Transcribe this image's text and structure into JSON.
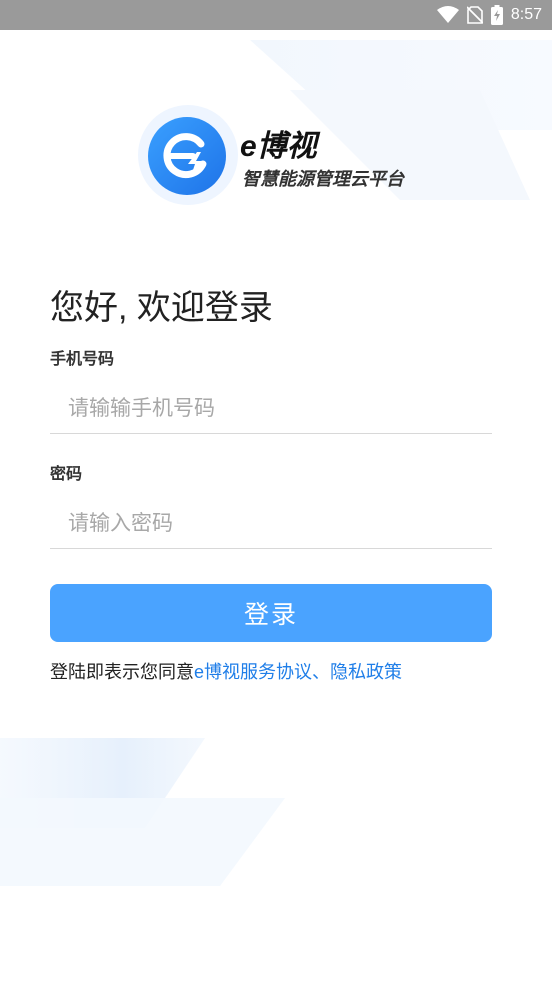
{
  "status_bar": {
    "time": "8:57",
    "icons": [
      "wifi-icon",
      "no-sim-icon",
      "battery-charging-icon"
    ]
  },
  "brand": {
    "title": "e博视",
    "subtitle": "智慧能源管理云平台",
    "logo_icon": "lightning-e-logo-icon",
    "accent_color": "#1e73e8"
  },
  "form": {
    "greeting": "您好, 欢迎登录",
    "phone": {
      "label": "手机号码",
      "placeholder": "请输输手机号码",
      "value": ""
    },
    "password": {
      "label": "密码",
      "placeholder": "请输入密码",
      "value": ""
    },
    "submit_label": "登录",
    "submit_color": "#4aa3ff"
  },
  "agreement": {
    "prefix": "登陆即表示您同意",
    "service_link": "e博视服务协议",
    "separator": "、",
    "privacy_link": "隐私政策",
    "link_color": "#1f7ee8"
  }
}
